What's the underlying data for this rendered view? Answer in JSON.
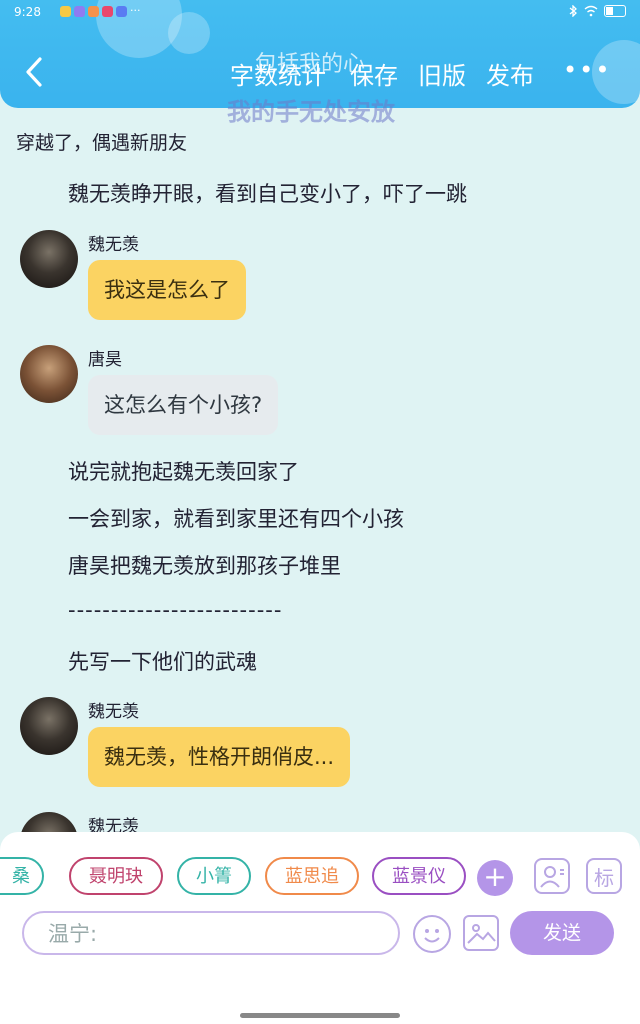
{
  "status_bar": {
    "time": "9:28",
    "more": "···"
  },
  "header": {
    "back_label": "‹",
    "word_count": "字数统计",
    "save": "保存",
    "old_version": "旧版",
    "publish": "发布",
    "more": "•••",
    "overlay_title": "包括我的心",
    "overlay_subtitle": "我的手无处安放"
  },
  "chapter_title": "穿越了，偶遇新朋友",
  "narration": [
    "魏无羡睁开眼，看到自己变小了，吓了一跳",
    "说完就抱起魏无羡回家了",
    "一会到家，就看到家里还有四个小孩",
    "唐昊把魏无羡放到那孩子堆里",
    "-------------------------",
    "先写一下他们的武魂"
  ],
  "messages": [
    {
      "name": "魏无羡",
      "text": "我这是怎么了",
      "style": "yellow"
    },
    {
      "name": "唐昊",
      "text": "这怎么有个小孩?",
      "style": "gray"
    },
    {
      "name": "魏无羡",
      "text": "魏无羡，性格开朗俏皮...",
      "style": "yellow"
    },
    {
      "name": "魏无羡",
      "text": ""
    }
  ],
  "characters": [
    {
      "label": "桑",
      "color": "#34b3a7"
    },
    {
      "label": "聂明玦",
      "color": "#c0436d"
    },
    {
      "label": "小箐",
      "color": "#34b3a7"
    },
    {
      "label": "蓝思追",
      "color": "#f08a4a"
    },
    {
      "label": "蓝景仪",
      "color": "#9a4fc2"
    }
  ],
  "toolbar": {
    "add": "+",
    "tag_label": "标",
    "input_value": "温宁:",
    "send_label": "发送"
  },
  "colors": {
    "header": "#3ab3ee",
    "accent": "#b495e8",
    "background": "#dff3f3"
  }
}
